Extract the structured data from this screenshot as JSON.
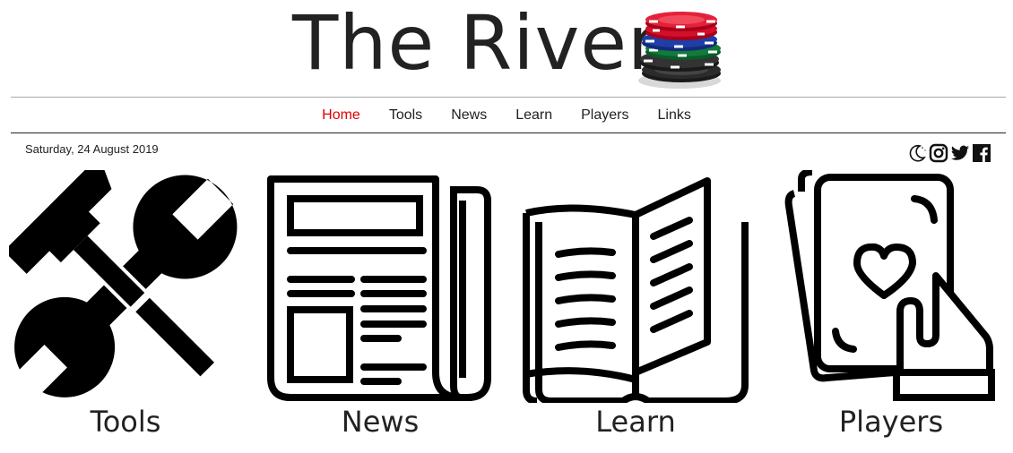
{
  "site": {
    "title": "The River",
    "logo_icon": "poker-chips-icon"
  },
  "nav": {
    "items": [
      {
        "label": "Home",
        "active": true
      },
      {
        "label": "Tools",
        "active": false
      },
      {
        "label": "News",
        "active": false
      },
      {
        "label": "Learn",
        "active": false
      },
      {
        "label": "Players",
        "active": false
      },
      {
        "label": "Links",
        "active": false
      }
    ],
    "active_color": "#e30000"
  },
  "date": "Saturday, 24 August 2019",
  "social": [
    "moon-icon",
    "instagram-icon",
    "twitter-icon",
    "facebook-icon"
  ],
  "tiles": [
    {
      "label": "Tools",
      "icon": "wrench-hammer-icon"
    },
    {
      "label": "News",
      "icon": "newspaper-icon"
    },
    {
      "label": "Learn",
      "icon": "open-book-icon"
    },
    {
      "label": "Players",
      "icon": "playing-cards-icon"
    }
  ]
}
